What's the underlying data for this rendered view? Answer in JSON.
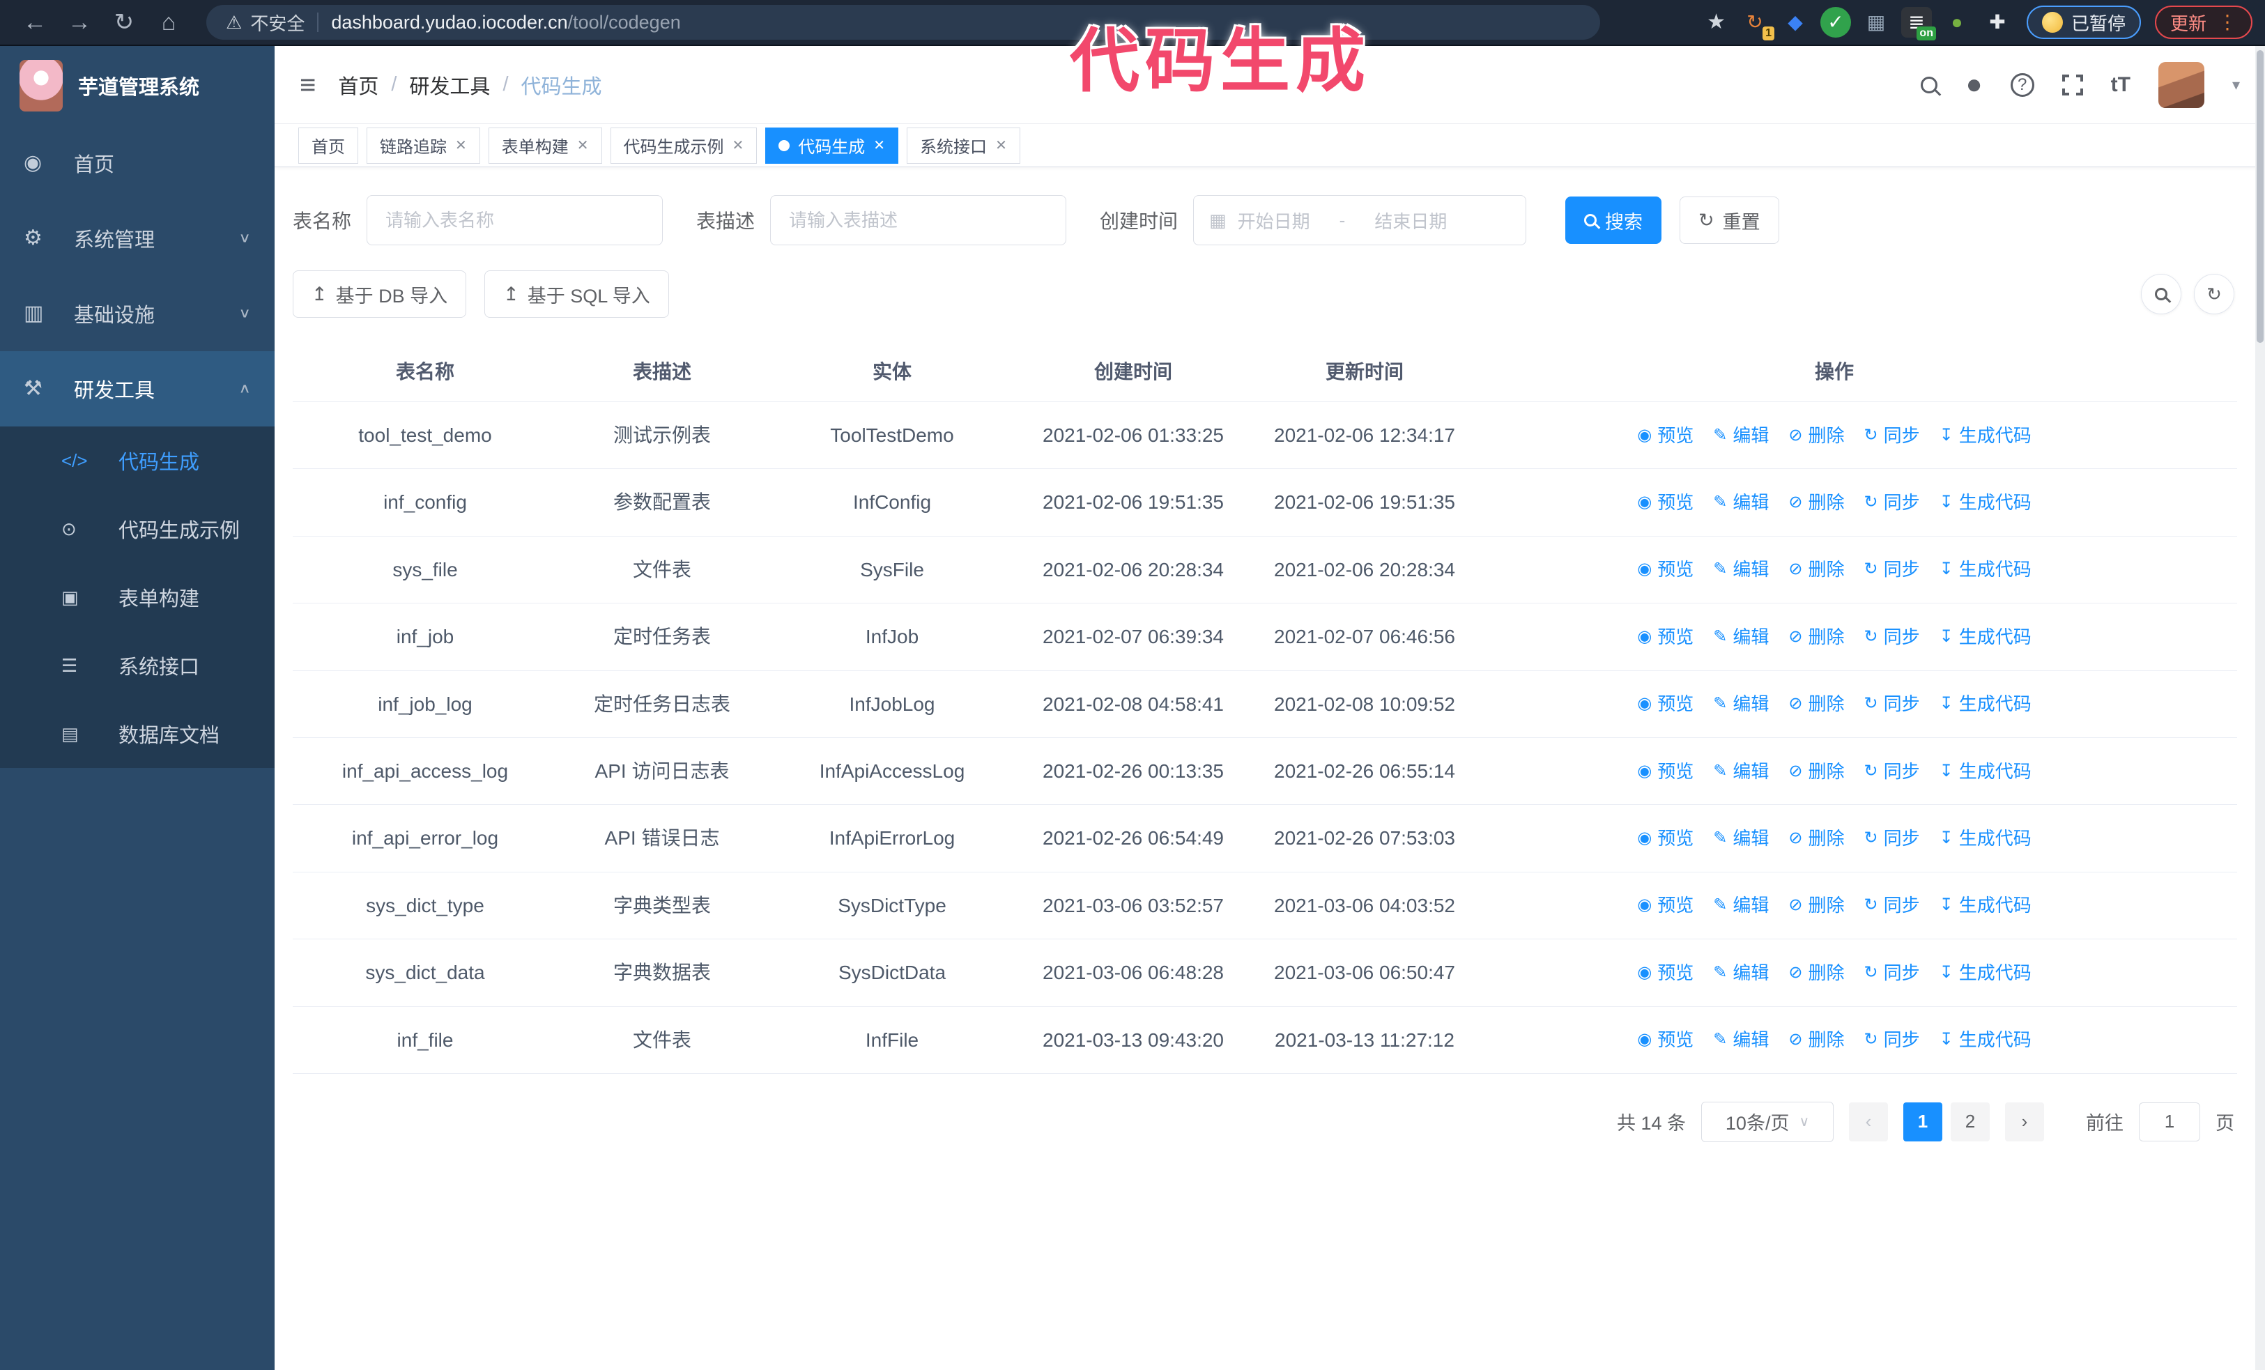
{
  "colors": {
    "primary": "#1890ff",
    "annotation": "#f2486c",
    "sidebar_bg": "#2b4a69",
    "submenu_bg": "#223a52"
  },
  "browser": {
    "security_text": "不安全",
    "url_host": "dashboard.yudao.iocoder.cn",
    "url_path": "/tool/codegen",
    "paused_label": "已暂停",
    "update_label": "更新",
    "extensions": [
      {
        "name": "ext-orange-refresh",
        "glyph": "refresh",
        "color": "#e8833a",
        "badge": "1"
      },
      {
        "name": "ext-blue-gem",
        "glyph": "diamond",
        "color": "#3b82f6"
      },
      {
        "name": "ext-green-check",
        "glyph": "check",
        "color": "#31a24c",
        "fill": true
      },
      {
        "name": "ext-grid",
        "glyph": "grid",
        "color": "#93a3b4"
      },
      {
        "name": "ext-on-toggle",
        "glyph": "rows",
        "color": "#30343a",
        "fill": true,
        "badge_on": "on"
      },
      {
        "name": "ext-green-bot",
        "glyph": "dot",
        "color": "#76b041"
      },
      {
        "name": "ext-puzzle",
        "glyph": "puzzle",
        "color": "#e8eaed"
      }
    ]
  },
  "annotation": {
    "text": "代码生成"
  },
  "sidebar": {
    "title": "芋道管理系统",
    "items": [
      {
        "label": "首页",
        "icon": "dashboard"
      },
      {
        "label": "系统管理",
        "icon": "gear",
        "arrow": "down"
      },
      {
        "label": "基础设施",
        "icon": "infra",
        "arrow": "down"
      },
      {
        "label": "研发工具",
        "icon": "tools",
        "arrow": "up",
        "open": true,
        "children": [
          {
            "label": "代码生成",
            "icon": "code",
            "active": true
          },
          {
            "label": "代码生成示例",
            "icon": "example"
          },
          {
            "label": "表单构建",
            "icon": "form"
          },
          {
            "label": "系统接口",
            "icon": "api"
          },
          {
            "label": "数据库文档",
            "icon": "db"
          }
        ]
      }
    ]
  },
  "header": {
    "breadcrumb": [
      "首页",
      "研发工具",
      "代码生成"
    ]
  },
  "tabs": [
    {
      "label": "首页",
      "closable": false,
      "active": false
    },
    {
      "label": "链路追踪",
      "closable": true,
      "active": false
    },
    {
      "label": "表单构建",
      "closable": true,
      "active": false
    },
    {
      "label": "代码生成示例",
      "closable": true,
      "active": false
    },
    {
      "label": "代码生成",
      "closable": true,
      "active": true
    },
    {
      "label": "系统接口",
      "closable": true,
      "active": false
    }
  ],
  "search": {
    "name_label": "表名称",
    "name_placeholder": "请输入表名称",
    "desc_label": "表描述",
    "desc_placeholder": "请输入表描述",
    "time_label": "创建时间",
    "start_placeholder": "开始日期",
    "range_separator": "-",
    "end_placeholder": "结束日期",
    "search_label": "搜索",
    "reset_label": "重置"
  },
  "toolbar": {
    "import_db_label": "基于 DB 导入",
    "import_sql_label": "基于 SQL 导入"
  },
  "table": {
    "headers": [
      "表名称",
      "表描述",
      "实体",
      "创建时间",
      "更新时间",
      "操作"
    ],
    "ops": [
      {
        "icon": "eye",
        "label": "预览"
      },
      {
        "icon": "edit",
        "label": "编辑"
      },
      {
        "icon": "delete",
        "label": "删除"
      },
      {
        "icon": "sync",
        "label": "同步"
      },
      {
        "icon": "download",
        "label": "生成代码"
      }
    ],
    "rows": [
      {
        "name": "tool_test_demo",
        "desc": "测试示例表",
        "entity": "ToolTestDemo",
        "created": "2021-02-06 01:33:25",
        "updated": "2021-02-06 12:34:17"
      },
      {
        "name": "inf_config",
        "desc": "参数配置表",
        "entity": "InfConfig",
        "created": "2021-02-06 19:51:35",
        "updated": "2021-02-06 19:51:35"
      },
      {
        "name": "sys_file",
        "desc": "文件表",
        "entity": "SysFile",
        "created": "2021-02-06 20:28:34",
        "updated": "2021-02-06 20:28:34"
      },
      {
        "name": "inf_job",
        "desc": "定时任务表",
        "entity": "InfJob",
        "created": "2021-02-07 06:39:34",
        "updated": "2021-02-07 06:46:56"
      },
      {
        "name": "inf_job_log",
        "desc": "定时任务日志表",
        "entity": "InfJobLog",
        "created": "2021-02-08 04:58:41",
        "updated": "2021-02-08 10:09:52"
      },
      {
        "name": "inf_api_access_log",
        "desc": "API 访问日志表",
        "entity": "InfApiAccessLog",
        "created": "2021-02-26 00:13:35",
        "updated": "2021-02-26 06:55:14"
      },
      {
        "name": "inf_api_error_log",
        "desc": "API 错误日志",
        "entity": "InfApiErrorLog",
        "created": "2021-02-26 06:54:49",
        "updated": "2021-02-26 07:53:03"
      },
      {
        "name": "sys_dict_type",
        "desc": "字典类型表",
        "entity": "SysDictType",
        "created": "2021-03-06 03:52:57",
        "updated": "2021-03-06 04:03:52"
      },
      {
        "name": "sys_dict_data",
        "desc": "字典数据表",
        "entity": "SysDictData",
        "created": "2021-03-06 06:48:28",
        "updated": "2021-03-06 06:50:47"
      },
      {
        "name": "inf_file",
        "desc": "文件表",
        "entity": "InfFile",
        "created": "2021-03-13 09:43:20",
        "updated": "2021-03-13 11:27:12"
      }
    ]
  },
  "pagination": {
    "total": "共 14 条",
    "page_size": "10条/页",
    "pages": [
      "1",
      "2"
    ],
    "active_page": "1",
    "goto_label": "前往",
    "goto_value": "1",
    "goto_suffix": "页"
  }
}
